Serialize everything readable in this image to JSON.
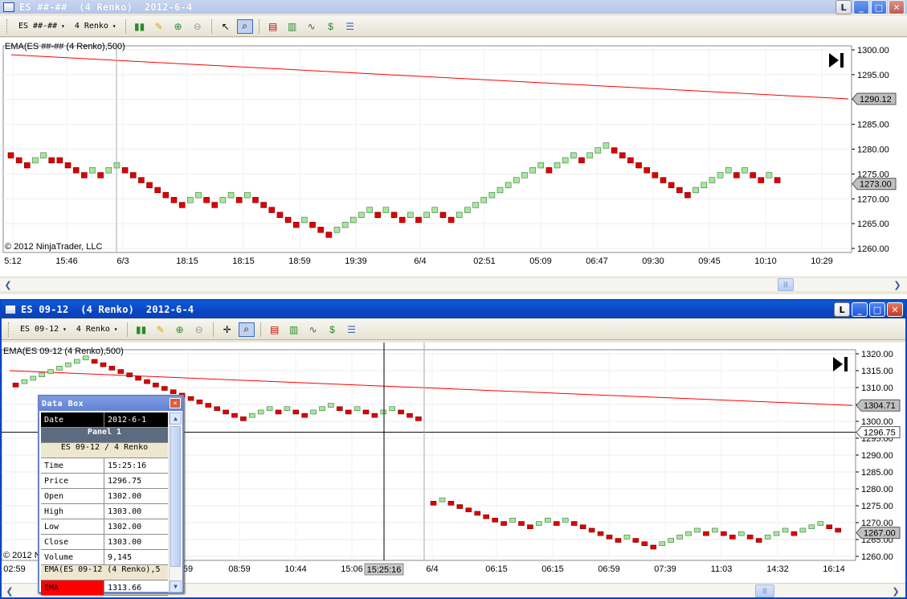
{
  "top_window": {
    "title": "ES ##-##  (4 Renko)  2012-6-4",
    "buttons": {
      "l": "L",
      "min": "_",
      "max": "□",
      "close": "✕"
    },
    "toolbar": {
      "instrument": "ES ##-##",
      "period": "4 Renko"
    },
    "indicator_label": "EMA(ES ##-## (4 Renko),500)",
    "copyright": "© 2012 NinjaTrader, LLC",
    "ema_tag": "1290.12",
    "price_tag": "1273.00",
    "y_ticks": [
      "1300.00",
      "1295.00",
      "1290.00",
      "1285.00",
      "1280.00",
      "1275.00",
      "1270.00",
      "1265.00",
      "1260.00"
    ],
    "x_ticks": [
      "5:12",
      "15:46",
      "6/3",
      "18:15",
      "18:15",
      "18:59",
      "19:39",
      "6/4",
      "02:51",
      "05:09",
      "06:47",
      "09:30",
      "09:45",
      "10:10",
      "10:29"
    ]
  },
  "bottom_window": {
    "title": "ES 09-12  (4 Renko)  2012-6-4",
    "buttons": {
      "l": "L",
      "min": "_",
      "max": "□",
      "close": "✕"
    },
    "toolbar": {
      "instrument": "ES 09-12",
      "period": "4 Renko"
    },
    "indicator_label": "EMA(ES 09-12 (4 Renko),500)",
    "copyright": "© 2012 N",
    "ema_tag": "1304.71",
    "crosshair_tag": "1296.75",
    "price_tag": "1267.00",
    "crosshair_time": "15:25:16",
    "y_ticks": [
      "1320.00",
      "1315.00",
      "1310.00",
      "1305.00",
      "1300.00",
      "1295.00",
      "1290.00",
      "1285.00",
      "1280.00",
      "1275.00",
      "1270.00",
      "1265.00",
      "1260.00"
    ],
    "x_ticks": [
      "02:59",
      "59",
      "08:59",
      "10:44",
      "15:06",
      "6/4",
      "06:15",
      "06:15",
      "06:59",
      "07:39",
      "11:03",
      "14:32",
      "16:14"
    ]
  },
  "data_box": {
    "title": "Data Box",
    "close": "✕",
    "date_label": "Date",
    "date_value": "2012-6-1",
    "panel": "Panel 1",
    "series": "ES 09-12 / 4 Renko",
    "rows": [
      {
        "k": "Time",
        "v": "15:25:16"
      },
      {
        "k": "Price",
        "v": "1296.75"
      },
      {
        "k": "Open",
        "v": "1302.00"
      },
      {
        "k": "High",
        "v": "1303.00"
      },
      {
        "k": "Low",
        "v": "1302.00"
      },
      {
        "k": "Close",
        "v": "1303.00"
      },
      {
        "k": "Volume",
        "v": "9,145"
      }
    ],
    "ema_header": "EMA(ES 09-12 (4 Renko),5",
    "ema_label": "EMA",
    "ema_value": "1313.66"
  },
  "colors": {
    "up": "#a8e6a0",
    "down": "#dd0000",
    "ema": "#ff0000",
    "tag": "#c0c0c0"
  },
  "chart_data": [
    {
      "type": "bar",
      "subtype": "renko",
      "ylim": [
        1260,
        1300
      ],
      "ema_series": {
        "name": "EMA(ES ##-## (4 Renko),500)",
        "start": 1299.0,
        "end": 1290.12
      },
      "bricks": [
        1278.75,
        1277.75,
        1276.75,
        1277.75,
        1278.75,
        1277.75,
        1277.75,
        1276.75,
        1275.75,
        1274.75,
        1275.75,
        1274.75,
        1275.75,
        1276.75,
        1275.75,
        1274.75,
        1273.75,
        1272.75,
        1271.75,
        1270.75,
        1269.75,
        1268.75,
        1269.75,
        1270.75,
        1269.75,
        1268.75,
        1269.75,
        1270.75,
        1269.75,
        1270.75,
        1269.75,
        1268.75,
        1267.75,
        1266.75,
        1265.75,
        1264.75,
        1265.75,
        1264.75,
        1263.75,
        1262.75,
        1263.75,
        1264.75,
        1265.75,
        1266.75,
        1267.75,
        1266.75,
        1267.75,
        1266.75,
        1265.75,
        1266.75,
        1265.75,
        1266.75,
        1267.75,
        1266.75,
        1265.75,
        1266.75,
        1267.75,
        1268.75,
        1269.75,
        1270.75,
        1271.75,
        1272.75,
        1273.75,
        1274.75,
        1275.75,
        1276.75,
        1275.75,
        1276.75,
        1277.75,
        1278.75,
        1277.75,
        1278.75,
        1279.75,
        1280.75,
        1279.75,
        1278.75,
        1277.75,
        1276.75,
        1275.75,
        1274.75,
        1273.75,
        1272.75,
        1271.75,
        1270.75,
        1271.75,
        1272.75,
        1273.75,
        1274.75,
        1275.75,
        1274.75,
        1275.75,
        1274.75,
        1273.75,
        1274.75,
        1273.75
      ],
      "directions": "dddddddddduddddddddduuddduddddddduudddddddduuuuuudduddduudduuuuuuuuuuudduuuuuuddddddddduuuuuudduudd"
    },
    {
      "type": "bar",
      "subtype": "renko",
      "ylim": [
        1260,
        1320
      ],
      "ema_series": {
        "name": "EMA(ES 09-12 (4 Renko),500)",
        "start": 1315.0,
        "end": 1304.71
      },
      "bricks": [
        1310.75,
        1311.75,
        1312.75,
        1313.75,
        1314.75,
        1315.75,
        1316.75,
        1317.75,
        1318.75,
        1317.75,
        1316.75,
        1315.75,
        1314.75,
        1313.75,
        1312.75,
        1311.75,
        1310.75,
        1309.75,
        1308.75,
        1307.75,
        1306.75,
        1305.75,
        1304.75,
        1303.75,
        1302.75,
        1301.75,
        1300.75,
        1301.75,
        1302.75,
        1303.75,
        1302.75,
        1303.75,
        1302.75,
        1301.75,
        1302.75,
        1303.75,
        1304.75,
        1303.75,
        1302.75,
        1303.75,
        1302.75,
        1301.75,
        1302.75,
        1303.75,
        1302.75,
        1301.75,
        1300.75
      ],
      "bricks2": [
        1275.75,
        1276.75,
        1275.75,
        1274.75,
        1273.75,
        1272.75,
        1271.75,
        1270.75,
        1269.75,
        1270.75,
        1269.75,
        1268.75,
        1269.75,
        1270.75,
        1269.75,
        1270.75,
        1269.75,
        1268.75,
        1267.75,
        1266.75,
        1265.75,
        1264.75,
        1265.75,
        1264.75,
        1263.75,
        1262.75,
        1263.75,
        1264.75,
        1265.75,
        1266.75,
        1267.75,
        1266.75,
        1267.75,
        1266.75,
        1265.75,
        1266.75,
        1265.75,
        1264.75,
        1265.75,
        1266.75,
        1267.75,
        1266.75,
        1267.75,
        1268.75,
        1269.75,
        1268.75,
        1267.75
      ]
    }
  ]
}
